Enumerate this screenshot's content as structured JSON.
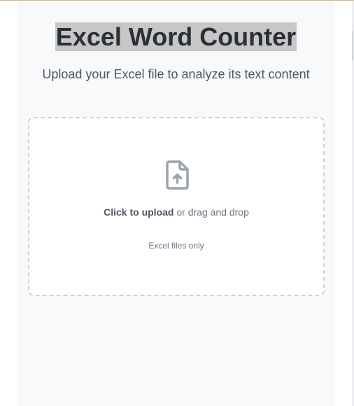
{
  "header": {
    "title": "Excel Word Counter",
    "subtitle": "Upload your Excel file to analyze its text content"
  },
  "dropzone": {
    "icon": "file-upload-icon",
    "click_label": "Click to upload",
    "drag_label": " or drag and drop",
    "hint": "Excel files only"
  },
  "colors": {
    "panel_background": "#f8f9fb",
    "title_text": "#2b2f36",
    "title_highlight": "#c7c7c7",
    "dropzone_border": "#cdd2da",
    "icon": "#9ca3af"
  }
}
